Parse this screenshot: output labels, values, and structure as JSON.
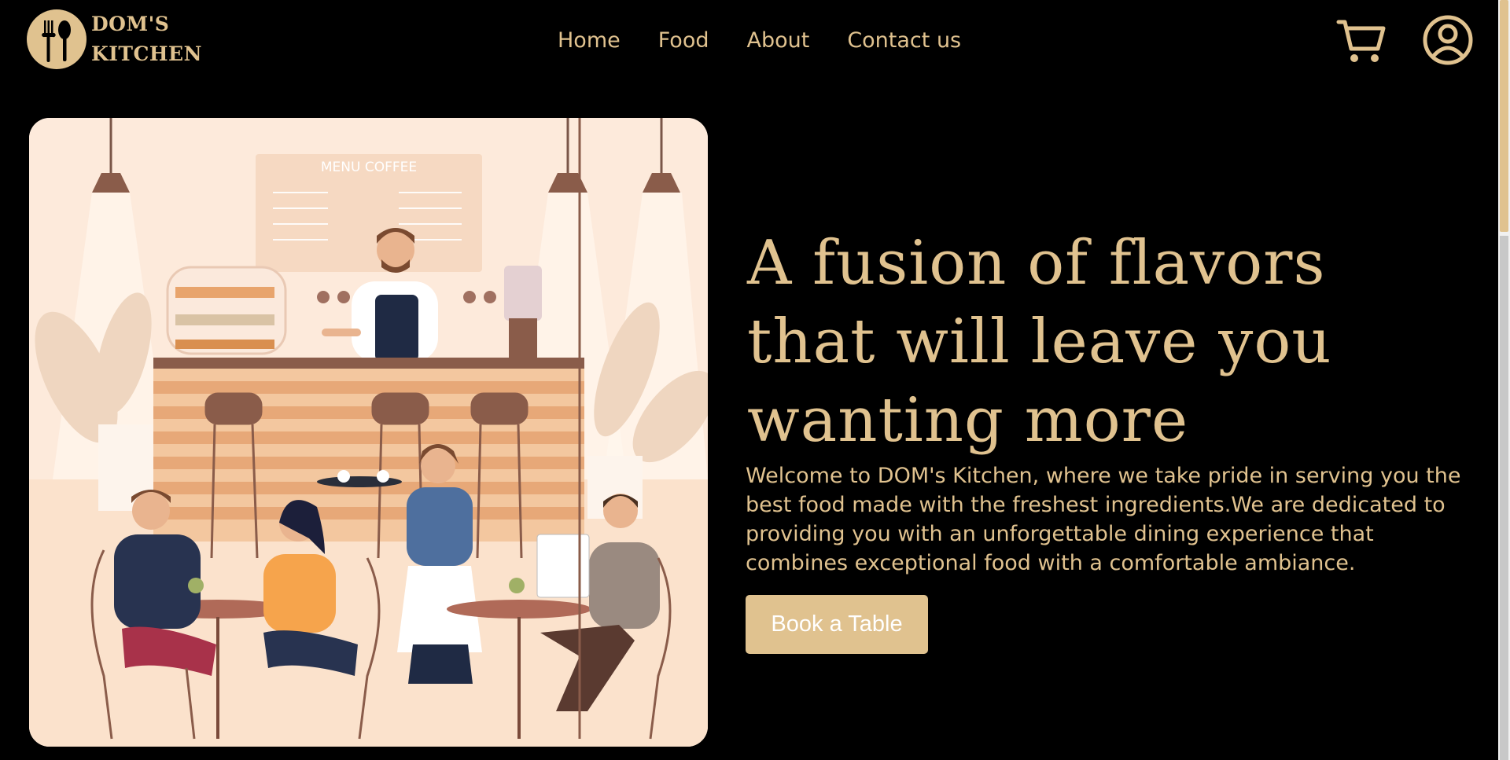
{
  "brand": {
    "line1": "DOM'S",
    "line2": "KITCHEN"
  },
  "nav": {
    "items": [
      "Home",
      "Food",
      "About",
      "Contact us"
    ]
  },
  "icons": {
    "cart": "cart-icon",
    "user": "user-circle-icon",
    "logo": "fork-spoon-icon"
  },
  "hero": {
    "illustration": {
      "menu_board_title": "MENU COFFEE"
    },
    "headline": "A fusion of flavors that will leave you wanting more",
    "description": "Welcome to DOM's Kitchen, where we take pride in serving you the best food made with the freshest ingredients.We are dedicated to providing you with an unforgettable dining experience that combines exceptional food with a comfortable ambiance.",
    "cta_label": "Book a Table"
  },
  "colors": {
    "accent": "#e0c28f",
    "background": "#000000",
    "illustration_bg": "#fdeadb"
  }
}
